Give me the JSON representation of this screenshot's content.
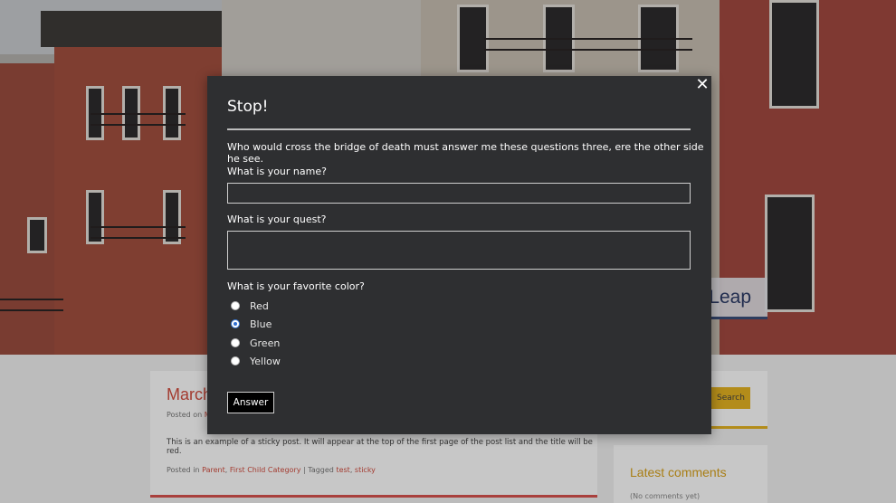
{
  "background": {
    "hero_badge": "Leap",
    "post": {
      "title": "March",
      "meta_prefix": "Posted on",
      "meta_link": "M",
      "body": "This is an example of a sticky post. It will appear at the top of the first page of the post list and the title will be red.",
      "footer_prefix": "Posted in",
      "category_1": "Parent",
      "category_sep": ", ",
      "category_2": "First Child Category",
      "tagged_label": " | Tagged",
      "tag_1": "test",
      "tag_sep": ", ",
      "tag_2": "sticky"
    },
    "search_button": "Search",
    "comments_widget": {
      "title": "Latest comments",
      "empty": "(No comments yet)"
    }
  },
  "modal": {
    "close_symbol": "✕",
    "title": "Stop!",
    "intro": "Who would cross the bridge of death must answer me these questions three, ere the other side he see.",
    "name_label": "What is your name?",
    "name_value": "",
    "quest_label": "What is your quest?",
    "quest_value": "",
    "color_label": "What is your favorite color?",
    "colors": [
      "Red",
      "Blue",
      "Green",
      "Yellow"
    ],
    "selected_color": "Blue",
    "answer_button": "Answer"
  },
  "colors": {
    "modal_bg": "#2e2f31",
    "accent_red": "#d24d3f",
    "accent_yellow": "#e6b422"
  }
}
